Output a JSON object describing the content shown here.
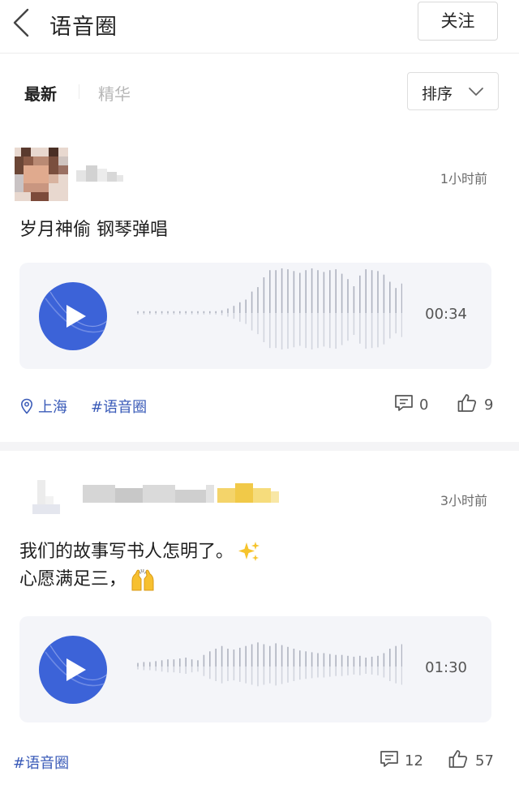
{
  "header": {
    "title": "语音圈",
    "follow_label": "关注",
    "back_icon": "chevron-left-icon"
  },
  "tabs": {
    "latest": "最新",
    "featured": "精华",
    "sort_label": "排序"
  },
  "colors": {
    "accent_blue": "#3c63d8",
    "link_blue": "#3a5bb8",
    "voice_bg": "#f4f5f9"
  },
  "posts": [
    {
      "time": "1小时前",
      "text_lines": [
        "岁月神偷 钢琴弹唱"
      ],
      "voice": {
        "duration": "00:34"
      },
      "location": "上海",
      "tag": "#语音圈",
      "comments": "0",
      "likes": "9"
    },
    {
      "time": "3小时前",
      "text_lines": [
        "我们的故事写书人怎明了。",
        "心愿满足三，"
      ],
      "emojis": [
        "sparkles",
        "raised-hands"
      ],
      "voice": {
        "duration": "01:30"
      },
      "tag": "#语音圈",
      "comments": "12",
      "likes": "57"
    }
  ]
}
